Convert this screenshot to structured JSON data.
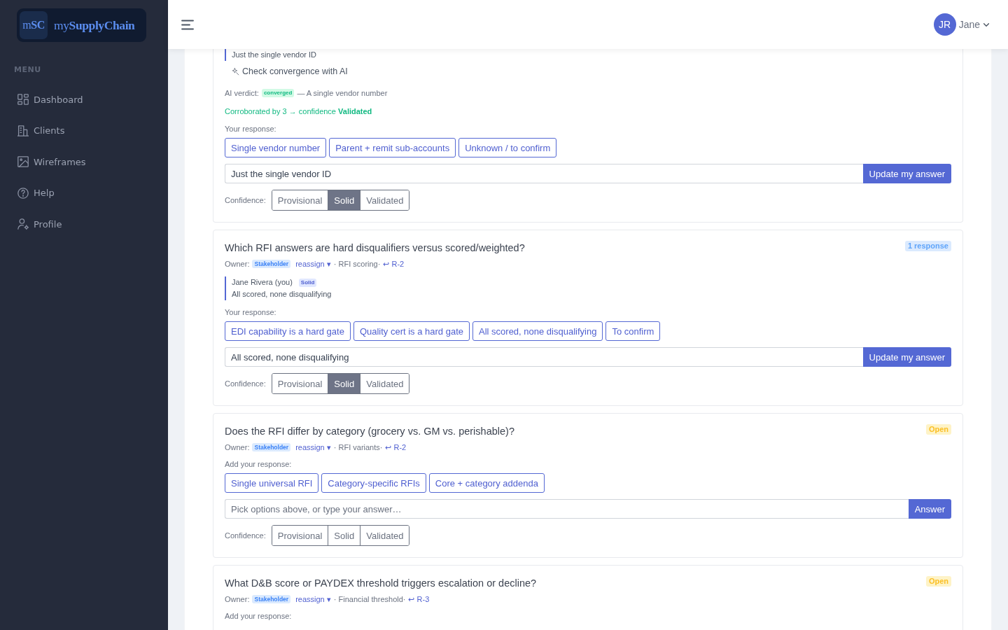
{
  "sidebar": {
    "logo": {
      "mark": "m**SC**",
      "wordmark": "my**SupplyChain**"
    },
    "menu_heading": "MENU",
    "items": [
      {
        "label": "Dashboard",
        "selected": false
      },
      {
        "label": "Clients",
        "selected": false
      },
      {
        "label": "Wireframes",
        "selected": false
      },
      {
        "label": "Help",
        "selected": false
      },
      {
        "label": "Profile",
        "selected": false
      }
    ]
  },
  "header": {
    "user": {
      "initials": "JR",
      "name": "Jane"
    }
  },
  "questions": [
    {
      "responses": [
        {
          "text": "Just the single vendor ID"
        }
      ],
      "ai_check": {
        "button": "Check convergence with AI",
        "verdict_label": "AI verdict:",
        "verdict": "converged",
        "verdict_text": "— A single vendor number",
        "corroboration": "Corroborated by 3 → confidence **Validated**"
      },
      "response_label": "Your response:",
      "options": [
        "Single vendor number",
        "Parent + remit sub-accounts",
        "Unknown / to confirm"
      ],
      "answer": {
        "value": "Just the single vendor ID",
        "button": "Update my answer"
      },
      "confidence": {
        "label": "Confidence:",
        "levels": [
          {
            "label": "Provisional",
            "selected": false
          },
          {
            "label": "Solid",
            "selected": true
          },
          {
            "label": "Validated",
            "selected": false
          }
        ]
      }
    },
    {
      "title": "Which RFI answers are hard disqualifiers versus scored/weighted?",
      "status": {
        "kind": "answered",
        "label": "1 response"
      },
      "owner": {
        "label": "Owner:",
        "role": "Stakeholder",
        "reassign": "reassign ▾",
        "topic": "· RFI scoring·",
        "ref": "↩ R-2"
      },
      "responses": [
        {
          "author": "Jane Rivera (you)",
          "confidence": "Solid",
          "text": "All scored, none disqualifying"
        }
      ],
      "response_label": "Your response:",
      "options": [
        "EDI capability is a hard gate",
        "Quality cert is a hard gate",
        "All scored, none disqualifying",
        "To confirm"
      ],
      "answer": {
        "value": "All scored, none disqualifying",
        "button": "Update my answer"
      },
      "confidence": {
        "label": "Confidence:",
        "levels": [
          {
            "label": "Provisional",
            "selected": false
          },
          {
            "label": "Solid",
            "selected": true
          },
          {
            "label": "Validated",
            "selected": false
          }
        ]
      }
    },
    {
      "title": "Does the RFI differ by category (grocery vs. GM vs. perishable)?",
      "status": {
        "kind": "open",
        "label": "Open"
      },
      "owner": {
        "label": "Owner:",
        "role": "Stakeholder",
        "reassign": "reassign ▾",
        "topic": "· RFI variants·",
        "ref": "↩ R-2"
      },
      "response_label": "Add your response:",
      "options": [
        "Single universal RFI",
        "Category-specific RFIs",
        "Core + category addenda"
      ],
      "answer": {
        "placeholder": "Pick options above, or type your answer…",
        "button": "Answer"
      },
      "confidence": {
        "label": "Confidence:",
        "levels": [
          {
            "label": "Provisional",
            "selected": false
          },
          {
            "label": "Solid",
            "selected": false
          },
          {
            "label": "Validated",
            "selected": false
          }
        ]
      }
    },
    {
      "title": "What D&B score or PAYDEX threshold triggers escalation or decline?",
      "status": {
        "kind": "open",
        "label": "Open"
      },
      "owner": {
        "label": "Owner:",
        "role": "Stakeholder",
        "reassign": "reassign ▾",
        "topic": "· Financial threshold·",
        "ref": "↩ R-3"
      },
      "response_label": "Add your response:"
    }
  ]
}
